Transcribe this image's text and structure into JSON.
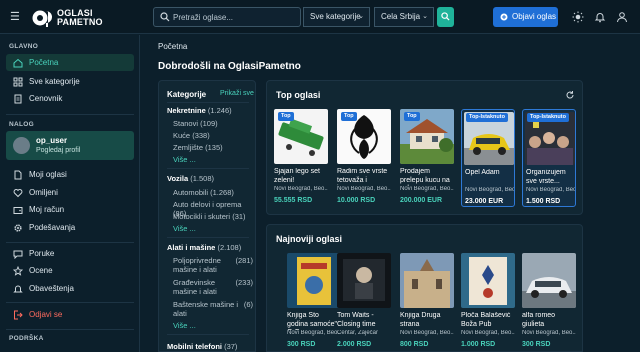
{
  "header": {
    "logo_text_1": "OGLASI",
    "logo_text_2": "PAMETNO",
    "search_placeholder": "Pretraži oglase...",
    "category_select": "Sve kategorije",
    "location_select": "Cela Srbija",
    "post_button": "Objavi oglas"
  },
  "sidebar": {
    "section_main": "GLAVNO",
    "main_items": [
      {
        "label": "Početna",
        "icon": "home-icon",
        "active": true
      },
      {
        "label": "Sve kategorije",
        "icon": "grid-icon"
      },
      {
        "label": "Cenovnik",
        "icon": "receipt-icon"
      }
    ],
    "section_account": "NALOG",
    "user": {
      "name": "op_user",
      "subtitle": "Pogledaj profil"
    },
    "account_items": [
      {
        "label": "Moji oglasi",
        "icon": "document-icon"
      },
      {
        "label": "Omiljeni",
        "icon": "heart-icon"
      },
      {
        "label": "Moj račun",
        "icon": "wallet-icon"
      },
      {
        "label": "Podešavanja",
        "icon": "gear-icon"
      }
    ],
    "extra_items": [
      {
        "label": "Poruke",
        "icon": "chat-icon"
      },
      {
        "label": "Ocene",
        "icon": "star-icon"
      },
      {
        "label": "Obaveštenja",
        "icon": "bell-icon"
      }
    ],
    "logout": "Odjavi se",
    "section_support": "PODRŠKA"
  },
  "main": {
    "breadcrumb": "Početna",
    "title": "Dobrodošli na OglasiPametno"
  },
  "categories": {
    "title": "Kategorije",
    "show_all": "Prikaži sve",
    "groups": [
      {
        "name": "Nekretnine",
        "count": "(1.246)",
        "items": [
          {
            "name": "Stanovi",
            "count": "(109)"
          },
          {
            "name": "Kuće",
            "count": "(338)"
          },
          {
            "name": "Zemljište",
            "count": "(135)"
          }
        ],
        "more": "Više ..."
      },
      {
        "name": "Vozila",
        "count": "(1.508)",
        "items": [
          {
            "name": "Automobili",
            "count": "(1.268)"
          },
          {
            "name": "Auto delovi i oprema",
            "count": "(86)"
          },
          {
            "name": "Motocikli i skuteri",
            "count": "(31)"
          }
        ],
        "more": "Više ..."
      },
      {
        "name": "Alati i mašine",
        "count": "(2.108)",
        "items": [
          {
            "name": "Poljoprivredne mašine i alati",
            "count": "(281)"
          },
          {
            "name": "Građevinske mašine i alati",
            "count": "(233)"
          },
          {
            "name": "Baštenske mašine i alati",
            "count": "(6)"
          }
        ],
        "more": "Više ..."
      },
      {
        "name": "Mobilni telefoni",
        "count": "(37)"
      }
    ]
  },
  "top_ads": {
    "title": "Top oglasi",
    "items": [
      {
        "name": "Sjajan lego set zeleni!",
        "location": "Novi Beograd, Beo...",
        "price": "55.555 RSD",
        "badge": "Top"
      },
      {
        "name": "Radim sve vrste tetovaža i imam...",
        "location": "Novi Beograd, Beo...",
        "price": "10.000 RSD",
        "badge": "Top"
      },
      {
        "name": "Prodajem prelepu kucu na selu",
        "location": "Novi Beograd, Beo...",
        "price": "200.000 EUR",
        "badge": "Top"
      },
      {
        "name": "Opel Adam",
        "location": "Novi Beograd, Beo...",
        "price": "23.000 EUR",
        "badge": "Top-Istaknuto"
      },
      {
        "name": "Organizujem sve vrste...",
        "location": "Novi Beograd, Beo...",
        "price": "1.500 RSD",
        "badge": "Top-Istaknuto"
      }
    ]
  },
  "new_ads": {
    "title": "Najnoviji oglasi",
    "items": [
      {
        "name": "Knjiga Sto godina samoće\" G.G...",
        "location": "Novi Beograd, Beo...",
        "price": "300 RSD"
      },
      {
        "name": "Tom Waits - Closing time",
        "location": "Centar, Zaječar",
        "price": "2.000 RSD"
      },
      {
        "name": "Knjiga Druga strana",
        "location": "Novi Beograd, Beo...",
        "price": "800 RSD"
      },
      {
        "name": "Ploča Balašević Boža Pub",
        "location": "Novi Beograd, Beo...",
        "price": "1.000 RSD"
      },
      {
        "name": "alfa romeo giulieta",
        "location": "Novi Beograd, Beo...",
        "price": "300 RSD"
      }
    ]
  }
}
